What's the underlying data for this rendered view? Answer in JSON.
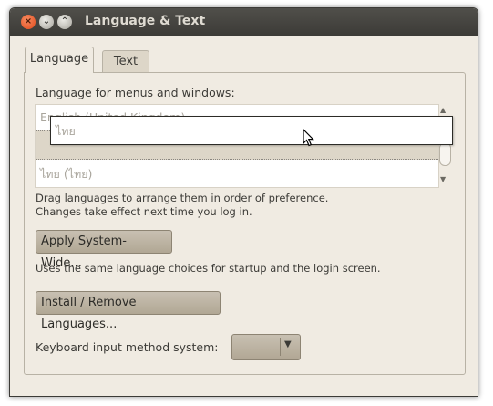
{
  "window": {
    "title": "Language & Text"
  },
  "tabs": [
    {
      "label": "Language"
    },
    {
      "label": "Text"
    }
  ],
  "language": {
    "menus_label": "Language for menus and windows:",
    "list_items": [
      {
        "label": "English (United Kingdom)"
      },
      {
        "label": ""
      },
      {
        "label": "ไทย (ไทย)"
      }
    ],
    "dragging_label": "ไทย",
    "hint_line1": "Drag languages to arrange them in order of preference.",
    "hint_line2": "Changes take effect next time you log in.",
    "apply_button": "Apply System-Wide...",
    "apply_hint": "Uses the same language choices for startup and the login screen.",
    "install_button": "Install / Remove Languages...",
    "input_method_label": "Keyboard input method system:",
    "input_method_value": ""
  },
  "icons": {
    "close": "close-icon",
    "minimize": "minimize-icon",
    "maximize": "maximize-icon",
    "scroll_up": "scroll-up-icon",
    "scroll_down": "scroll-down-icon",
    "pointer": "mouse-pointer-icon",
    "dropdown": "dropdown-arrow-icon"
  }
}
